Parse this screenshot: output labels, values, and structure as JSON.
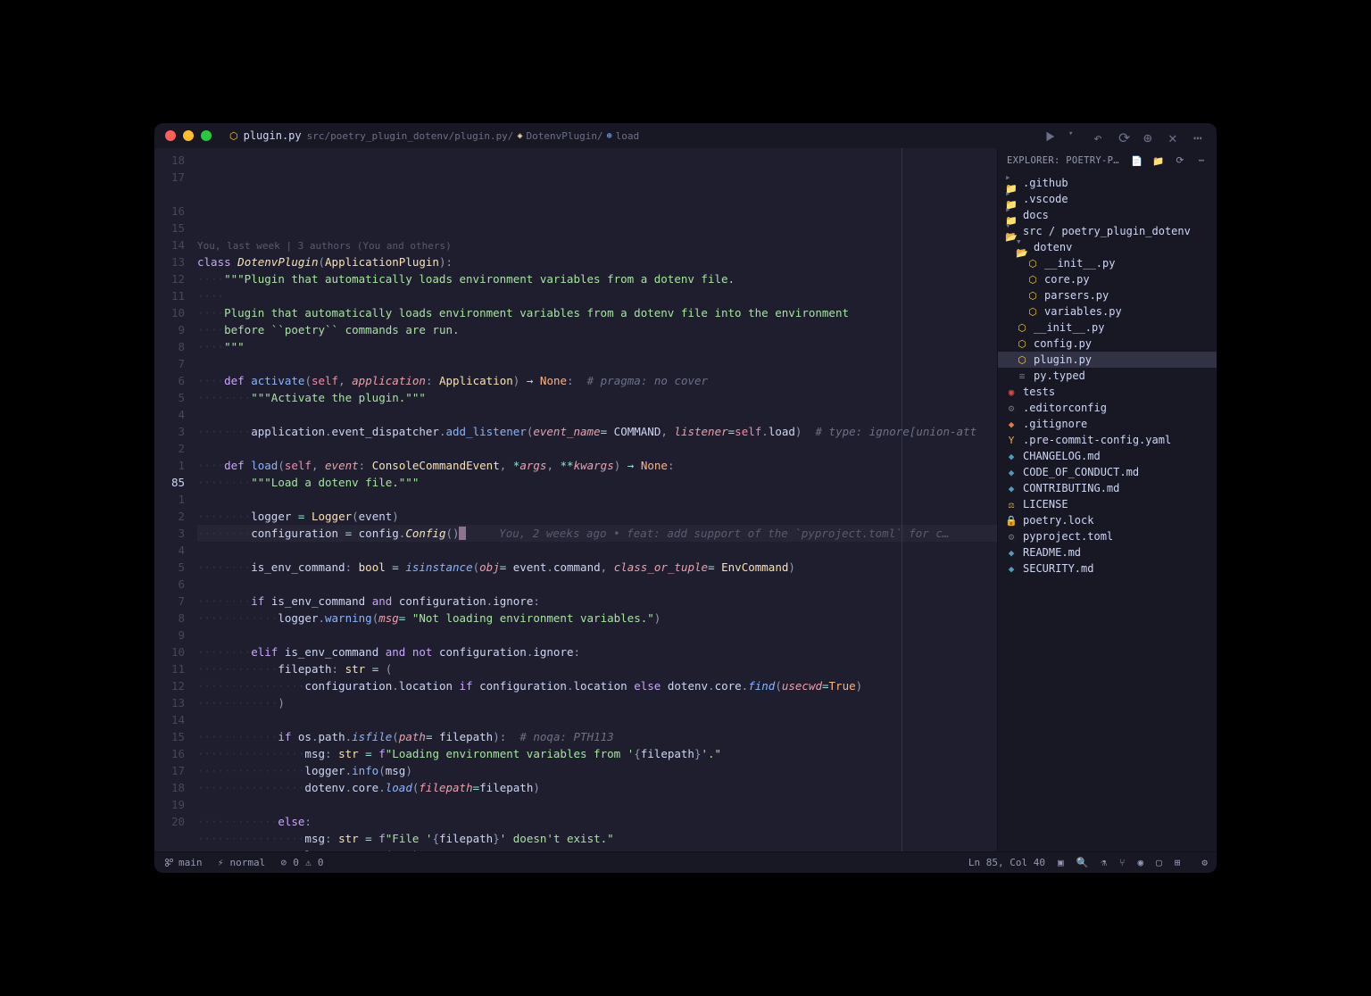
{
  "tab": {
    "filename": "plugin.py",
    "icon": "python"
  },
  "breadcrumb": [
    "src/poetry_plugin_dotenv/plugin.py/",
    "DotenvPlugin/",
    "load"
  ],
  "lens": "You, last week | 3 authors (You and others)",
  "blame_inline": "     You, 2 weeks ago • feat: add support of the `pyproject.toml` for c…",
  "gutter": [
    "18",
    "17",
    "",
    "16",
    "15",
    "14",
    "13",
    "12",
    "11",
    "10",
    "9",
    "8",
    "7",
    "6",
    "5",
    "4",
    "3",
    "2",
    "1",
    "85",
    "1",
    "2",
    "3",
    "4",
    "5",
    "6",
    "7",
    "8",
    "9",
    "10",
    "11",
    "12",
    "13",
    "14",
    "15",
    "16",
    "17",
    "18",
    "19",
    "20"
  ],
  "current_line_idx": 19,
  "explorer": {
    "title": "EXPLORER: POETRY-PLUGIN-…",
    "items": [
      {
        "d": 0,
        "i": "folder",
        "n": ".github"
      },
      {
        "d": 0,
        "i": "folder",
        "n": ".vscode"
      },
      {
        "d": 0,
        "i": "folder",
        "n": "docs"
      },
      {
        "d": 0,
        "i": "folder-open",
        "n": "src / poetry_plugin_dotenv"
      },
      {
        "d": 1,
        "i": "folder-open",
        "n": "dotenv"
      },
      {
        "d": 2,
        "i": "py",
        "n": "__init__.py"
      },
      {
        "d": 2,
        "i": "py",
        "n": "core.py"
      },
      {
        "d": 2,
        "i": "py",
        "n": "parsers.py"
      },
      {
        "d": 2,
        "i": "py",
        "n": "variables.py"
      },
      {
        "d": 1,
        "i": "py",
        "n": "__init__.py"
      },
      {
        "d": 1,
        "i": "py",
        "n": "config.py"
      },
      {
        "d": 1,
        "i": "py",
        "n": "plugin.py",
        "sel": true
      },
      {
        "d": 1,
        "i": "txt",
        "n": "py.typed"
      },
      {
        "d": 0,
        "i": "test",
        "n": "tests"
      },
      {
        "d": 0,
        "i": "cfg",
        "n": ".editorconfig"
      },
      {
        "d": 0,
        "i": "git",
        "n": ".gitignore"
      },
      {
        "d": 0,
        "i": "yaml",
        "n": ".pre-commit-config.yaml"
      },
      {
        "d": 0,
        "i": "md",
        "n": "CHANGELOG.md"
      },
      {
        "d": 0,
        "i": "md",
        "n": "CODE_OF_CONDUCT.md"
      },
      {
        "d": 0,
        "i": "md",
        "n": "CONTRIBUTING.md"
      },
      {
        "d": 0,
        "i": "lic",
        "n": "LICENSE"
      },
      {
        "d": 0,
        "i": "lock",
        "n": "poetry.lock"
      },
      {
        "d": 0,
        "i": "cfg",
        "n": "pyproject.toml"
      },
      {
        "d": 0,
        "i": "md",
        "n": "README.md"
      },
      {
        "d": 0,
        "i": "md",
        "n": "SECURITY.md"
      }
    ]
  },
  "status": {
    "branch": "main",
    "mode": "normal",
    "errors": "0",
    "warnings": "0",
    "position": "Ln 85, Col 40"
  },
  "code_lines": {
    "l3": {
      "kw": "class",
      "sp": " ",
      "cls": "DotenvPlugin",
      "p1": "(",
      "base": "ApplicationPlugin",
      "p2": "):"
    },
    "l4": "\"\"\"Plugin that automatically loads environment variables from a dotenv file.",
    "l6": "Plugin that automatically loads environment variables from a dotenv file into the environment",
    "l7a": "before ",
    "l7b": "``poetry``",
    "l7c": " commands are run.",
    "l8": "\"\"\"",
    "l10": {
      "def": "def",
      "sp": " ",
      "fn": "activate",
      "p1": "(",
      "self": "self",
      "c1": ", ",
      "p": "application",
      "col": ": ",
      "t": "Application",
      "p2": ") ",
      "arr": "→",
      "sp2": " ",
      "ret": "None",
      "p3": ":  ",
      "cm": "# pragma: no cover"
    },
    "l11": "\"\"\"Activate the plugin.\"\"\"",
    "l13": {
      "a": "application",
      "d": ".",
      "b": "event_dispatcher",
      "d2": ".",
      "c": "add_listener",
      "p1": "(",
      "k1": "event_name",
      "eq": "= ",
      "v1": "COMMAND",
      "c1": ", ",
      "k2": "listener",
      "eq2": "=",
      "s": "self",
      "d3": ".",
      "m": "load",
      "p2": ")  ",
      "cm": "# type: ignore[union-att"
    },
    "l15": {
      "def": "def",
      "sp": " ",
      "fn": "load",
      "p1": "(",
      "self": "self",
      "c1": ", ",
      "p": "event",
      "col": ": ",
      "t": "ConsoleCommandEvent",
      "c2": ", ",
      "st": "*",
      "ar": "args",
      "c3": ", ",
      "ds": "**",
      "kw": "kwargs",
      "p2": ") ",
      "arr": "→",
      "sp2": " ",
      "ret": "None",
      "p3": ":"
    },
    "l16": "\"\"\"Load a dotenv file.\"\"\"",
    "l18": {
      "v": "logger ",
      "eq": "=",
      "sp": " ",
      "c": "Logger",
      "p1": "(",
      "a": "event",
      "p2": ")"
    },
    "l19": {
      "v": "configuration ",
      "eq": "=",
      "sp": " ",
      "m": "config",
      "d": ".",
      "c": "Config",
      "p1": "(",
      "p2": ")"
    },
    "l21": {
      "v": "is_env_command",
      "col": ": ",
      "t": "bool",
      "sp": " ",
      "eq": "=",
      "sp2": " ",
      "fn": "isinstance",
      "p1": "(",
      "k1": "obj",
      "e1": "= ",
      "a1": "event",
      "d": ".",
      "a2": "command",
      "c": ", ",
      "k2": "class_or_tuple",
      "e2": "= ",
      "cl": "EnvCommand",
      "p2": ")"
    },
    "l23": {
      "if": "if",
      "sp": " ",
      "a": "is_env_command ",
      "and": "and",
      "sp2": " ",
      "b": "configuration",
      "d": ".",
      "c": "ignore",
      "p": ":"
    },
    "l24": {
      "a": "logger",
      "d": ".",
      "fn": "warning",
      "p1": "(",
      "k": "msg",
      "eq": "= ",
      "s": "\"Not loading environment variables.\"",
      "p2": ")"
    },
    "l26": {
      "el": "elif",
      "sp": " ",
      "a": "is_env_command ",
      "and": "and",
      "sp2": " ",
      "not": "not",
      "sp3": " ",
      "b": "configuration",
      "d": ".",
      "c": "ignore",
      "p": ":"
    },
    "l27": {
      "v": "filepath",
      "col": ": ",
      "t": "str",
      "sp": " ",
      "eq": "=",
      "sp2": " (",
      "p": ""
    },
    "l28": {
      "a": "configuration",
      "d": ".",
      "b": "location ",
      "if": "if",
      "sp": " ",
      "c": "configuration",
      "d2": ".",
      "e": "location ",
      "el": "else",
      "sp2": " ",
      "f": "dotenv",
      "d3": ".",
      "g": "core",
      "d4": ".",
      "fn": "find",
      "p1": "(",
      "k": "usecwd",
      "eq": "=",
      "tv": "True",
      "p2": ")"
    },
    "l29": ")",
    "l31": {
      "if": "if",
      "sp": " ",
      "a": "os",
      "d": ".",
      "b": "path",
      "d2": ".",
      "fn": "isfile",
      "p1": "(",
      "k": "path",
      "eq": "= ",
      "v": "filepath",
      "p2": "):  ",
      "cm": "# noqa: PTH113"
    },
    "l32": {
      "v": "msg",
      "col": ": ",
      "t": "str",
      "sp": " ",
      "eq": "=",
      "sp2": " ",
      "f": "f",
      "s1": "\"Loading environment variables from '",
      "b1": "{",
      "e": "filepath",
      "b2": "}",
      "s2": "'.\""
    },
    "l33": {
      "a": "logger",
      "d": ".",
      "fn": "info",
      "p1": "(",
      "v": "msg",
      "p2": ")"
    },
    "l34": {
      "a": "dotenv",
      "d": ".",
      "b": "core",
      "d2": ".",
      "fn": "load",
      "p1": "(",
      "k": "filepath",
      "eq": "=",
      "v": "filepath",
      "p2": ")"
    },
    "l36": {
      "el": "else",
      "p": ":"
    },
    "l37": {
      "v": "msg",
      "col": ": ",
      "t": "str",
      "sp": " ",
      "eq": "=",
      "sp2": " ",
      "f": "f",
      "s1": "\"File '",
      "b1": "{",
      "e": "filepath",
      "b2": "}",
      "s2": "' doesn't exist.\""
    },
    "l38": {
      "a": "logger",
      "d": ".",
      "fn": "error",
      "p1": "(",
      "v": "msg",
      "p2": ")"
    }
  }
}
